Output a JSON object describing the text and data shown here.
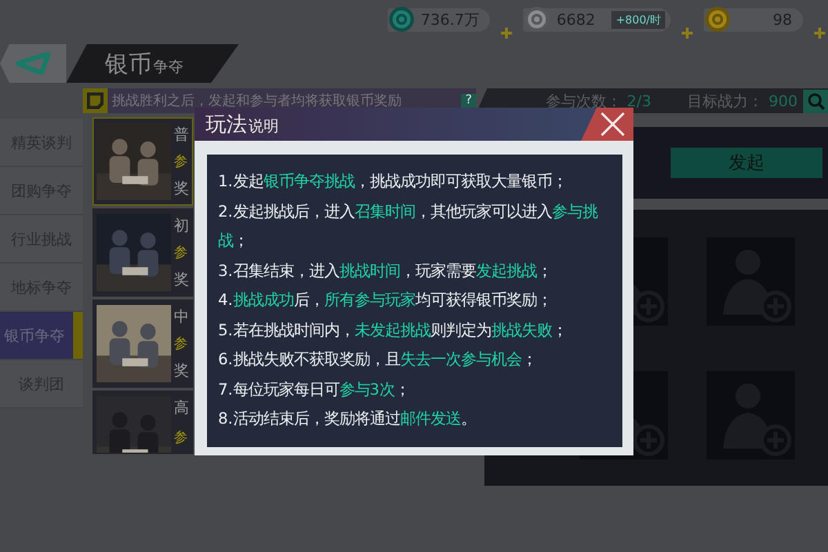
{
  "currencies": [
    {
      "kind": "teal",
      "value": "736.7万"
    },
    {
      "kind": "silver",
      "value": "6682",
      "rate": "+800/时"
    },
    {
      "kind": "gold",
      "value": "98"
    }
  ],
  "header": {
    "title": "银币",
    "subtitle": "争夺"
  },
  "ticker": {
    "text": "挑战胜利之后，发起和参与者均将获取银币奖励",
    "badge": "?"
  },
  "stats": {
    "attempts_label": "参与次数：",
    "attempts": "2/3",
    "power_label": "目标战力：",
    "power": "900"
  },
  "sidebar": {
    "items": [
      {
        "label": "精英谈判",
        "selected": false
      },
      {
        "label": "团购争夺",
        "selected": false
      },
      {
        "label": "行业挑战",
        "selected": false
      },
      {
        "label": "地标争夺",
        "selected": false
      },
      {
        "label": "银币争夺",
        "selected": true
      },
      {
        "label": "谈判团",
        "selected": false
      }
    ]
  },
  "events": [
    {
      "title": "普",
      "line_1": "参",
      "line_2": "奖",
      "selected": true
    },
    {
      "title": "初",
      "line_1": "参",
      "line_2": "奖",
      "selected": false
    },
    {
      "title": "中",
      "line_1": "参",
      "line_2": "奖",
      "selected": false
    },
    {
      "title": "高",
      "line_1": "参",
      "selected": false
    }
  ],
  "start_button": "发起",
  "dialog": {
    "title": "玩法",
    "title_suffix": "说明",
    "rules": [
      [
        {
          "text": "1.发起",
          "highlight": false
        },
        {
          "text": "银币争夺挑战",
          "highlight": true
        },
        {
          "text": "，挑战成功即可获取大量银币；",
          "highlight": false
        }
      ],
      [
        {
          "text": "2.发起挑战后，进入",
          "highlight": false
        },
        {
          "text": "召集时间",
          "highlight": true
        },
        {
          "text": "，其他玩家可以进入",
          "highlight": false
        },
        {
          "text": "参与挑战",
          "highlight": true
        },
        {
          "text": "；",
          "highlight": false
        }
      ],
      [
        {
          "text": "3.召集结束，进入",
          "highlight": false
        },
        {
          "text": "挑战时间",
          "highlight": true
        },
        {
          "text": "，玩家需要",
          "highlight": false
        },
        {
          "text": "发起挑战",
          "highlight": true
        },
        {
          "text": "；",
          "highlight": false
        }
      ],
      [
        {
          "text": "4.",
          "highlight": false
        },
        {
          "text": "挑战成功",
          "highlight": true
        },
        {
          "text": "后，",
          "highlight": false
        },
        {
          "text": "所有参与玩家",
          "highlight": true
        },
        {
          "text": "均可获得银币奖励；",
          "highlight": false
        }
      ],
      [
        {
          "text": "5.若在挑战时间内，",
          "highlight": false
        },
        {
          "text": "未发起挑战",
          "highlight": true
        },
        {
          "text": "则判定为",
          "highlight": false
        },
        {
          "text": "挑战失败",
          "highlight": true
        },
        {
          "text": "；",
          "highlight": false
        }
      ],
      [
        {
          "text": "6.挑战失败不获取奖励，且",
          "highlight": false
        },
        {
          "text": "失去一次参与机会",
          "highlight": true
        },
        {
          "text": "；",
          "highlight": false
        }
      ],
      [
        {
          "text": "7.每位玩家每日可",
          "highlight": false
        },
        {
          "text": "参与3次",
          "highlight": true
        },
        {
          "text": "；",
          "highlight": false
        }
      ],
      [
        {
          "text": "8.活动结束后，奖励将通过",
          "highlight": false
        },
        {
          "text": "邮件发送",
          "highlight": true
        },
        {
          "text": "。",
          "highlight": false
        }
      ]
    ]
  }
}
